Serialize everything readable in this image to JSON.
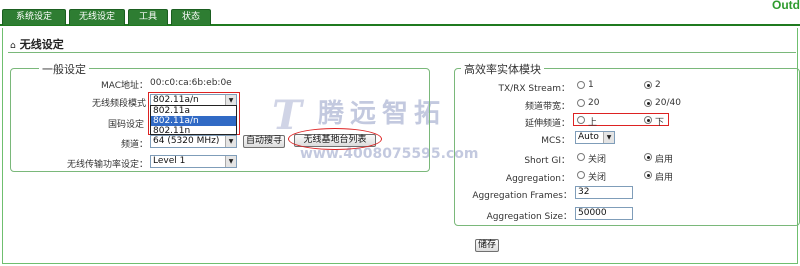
{
  "tabs": [
    {
      "label": "系统设定"
    },
    {
      "label": "无线设定"
    },
    {
      "label": "工具"
    },
    {
      "label": "状态"
    }
  ],
  "brand_text": "Outd",
  "page_title": "无线设定",
  "general": {
    "legend": "一般设定",
    "mac_label": "MAC地址：",
    "mac_value": "00:c0:ca:6b:eb:0e",
    "band_label": "无线频段模式",
    "band_value": "802.11a/n",
    "band_options": [
      "802.11a",
      "802.11a/n",
      "802.11n"
    ],
    "band_selected_index": 1,
    "country_label": "国码设定",
    "channel_label": "频道：",
    "channel_value": "64 (5320 MHz)",
    "auto_search_button": "自动搜寻",
    "site_survey_button": "无线基地台列表",
    "power_label": "无线传输功率设定：",
    "power_value": "Level 1"
  },
  "ht": {
    "legend": "高效率实体模块",
    "stream_label": "TX/RX Stream：",
    "stream_options": [
      "1",
      "2"
    ],
    "stream_selected": 1,
    "bandwidth_label": "频道带宽：",
    "bandwidth_options": [
      "20",
      "20/40"
    ],
    "bandwidth_selected": 1,
    "ext_channel_label": "延伸频道：",
    "ext_channel_options": [
      "上",
      "下"
    ],
    "ext_channel_selected": 1,
    "mcs_label": "MCS：",
    "mcs_value": "Auto",
    "short_gi_label": "Short GI：",
    "short_gi_options": [
      "关闭",
      "启用"
    ],
    "short_gi_selected": 1,
    "aggregation_label": "Aggregation：",
    "aggregation_options": [
      "关闭",
      "启用"
    ],
    "aggregation_selected": 1,
    "agg_frames_label": "Aggregation Frames：",
    "agg_frames_value": "32",
    "agg_size_label": "Aggregation Size：",
    "agg_size_value": "50000"
  },
  "save_button": "储存",
  "watermark": {
    "brand": "腾远智拓",
    "url": "www.4008075595.com"
  },
  "colors": {
    "tab_bg": "#2e7d32",
    "panel_border": "#7ab87a",
    "highlight_red": "#dd2222",
    "select_highlight": "#316ac5"
  }
}
